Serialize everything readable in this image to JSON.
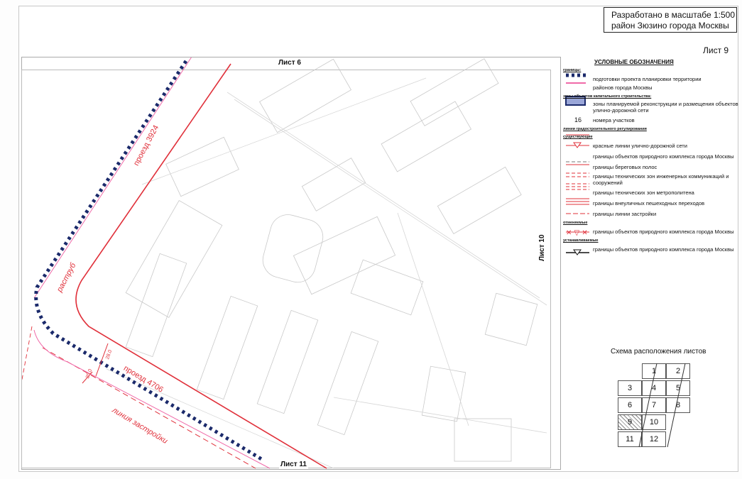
{
  "title": {
    "line1": "Разработано в масштабе 1:500",
    "line2": "район Зюзино города Москвы"
  },
  "sheet_label": "Лист 9",
  "edges": {
    "top": "Лист 6",
    "bottom": "Лист 11",
    "right": "Лист 10"
  },
  "map_labels": {
    "road_1": "проезд 3924",
    "road_2": "проезд 4706",
    "flare": "раструб",
    "building_line": "линия застройки",
    "dim_1": "28.0",
    "dim_2": "25.0"
  },
  "legend": {
    "heading": "УСЛОВНЫЕ ОБОЗНАЧЕНИЯ",
    "groups": [
      {
        "title": "границы:",
        "items": [
          {
            "symbol": "blue-dotted-line",
            "label": "подготовки проекта планировки территории"
          },
          {
            "symbol": "pink-line",
            "label": "районов города Москвы"
          }
        ]
      },
      {
        "title": "зоны объектов капитального строительства:",
        "items": [
          {
            "symbol": "blue-hatched-box",
            "label": "зоны планируемой реконструкции и размещения объектов улично-дорожной сети"
          },
          {
            "symbol": "number-16",
            "label": "номера участков"
          }
        ]
      },
      {
        "title": "линии градостроительного регулирования",
        "items": []
      },
      {
        "title": "существующие",
        "items": [
          {
            "symbol": "red-thin-line",
            "label": "красные линии улично-дорожной сети"
          },
          {
            "symbol": "red-triangle-line",
            "label": "границы объектов природного комплекса города Москвы"
          },
          {
            "symbol": "dashed-double",
            "label": "границы береговых полос"
          },
          {
            "symbol": "dashed-red-double",
            "label": "границы технических зон инженерных коммуникаций и сооружений"
          },
          {
            "symbol": "dashed-red-triple",
            "label": "границы технических зон метрополитена"
          },
          {
            "symbol": "red-stripes",
            "label": "границы внеуличных пешеходных переходов"
          },
          {
            "symbol": "red-dashed",
            "label": "границы линии застройки"
          }
        ]
      },
      {
        "title": "отменяемые",
        "items": [
          {
            "symbol": "red-crossed",
            "label": "границы объектов природного комплекса города Москвы"
          }
        ]
      },
      {
        "title": "устанавливаемые",
        "items": [
          {
            "symbol": "black-triangle-line",
            "label": "границы объектов природного комплекса города Москвы"
          }
        ]
      }
    ],
    "number_sample": "16"
  },
  "schema": {
    "title": "Схема расположения листов",
    "cells": [
      "1",
      "2",
      "3",
      "4",
      "5",
      "6",
      "7",
      "8",
      "9",
      "10",
      "11",
      "12"
    ],
    "highlighted": "9"
  },
  "colors": {
    "red_line": "#e0303a",
    "boundary": "#1b2a6b",
    "pink": "#f06aa8"
  }
}
